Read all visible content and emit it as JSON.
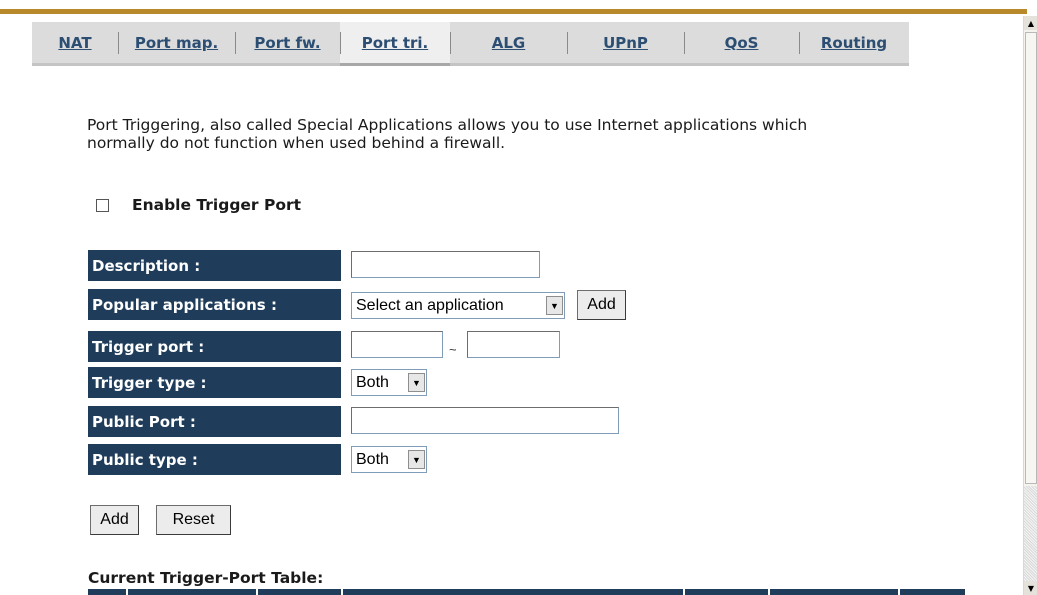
{
  "tabs": [
    {
      "label": "NAT"
    },
    {
      "label": "Port map."
    },
    {
      "label": "Port fw."
    },
    {
      "label": "Port tri.",
      "active": true
    },
    {
      "label": "ALG"
    },
    {
      "label": "UPnP"
    },
    {
      "label": "QoS"
    },
    {
      "label": "Routing"
    }
  ],
  "intro": {
    "line1": "Port Triggering, also called Special Applications allows you to use Internet applications which",
    "line2": "normally do not function when used behind a firewall."
  },
  "enable": {
    "label": "Enable Trigger Port",
    "checked": false
  },
  "form": {
    "description_label": "Description :",
    "description_value": "",
    "popular_label": "Popular applications :",
    "popular_selected": "Select an application",
    "popular_add": "Add",
    "trigger_port_label": "Trigger port :",
    "trigger_port_from": "",
    "trigger_port_sep": "~",
    "trigger_port_to": "",
    "trigger_type_label": "Trigger type :",
    "trigger_type_selected": "Both",
    "public_port_label": "Public Port :",
    "public_port_value": "",
    "public_type_label": "Public type :",
    "public_type_selected": "Both"
  },
  "buttons": {
    "add": "Add",
    "reset": "Reset"
  },
  "table": {
    "title": "Current Trigger-Port Table:"
  },
  "colors": {
    "accent_rule": "#b8892a",
    "label_bg": "#1f3d5a",
    "tab_text": "#2b4e72"
  }
}
